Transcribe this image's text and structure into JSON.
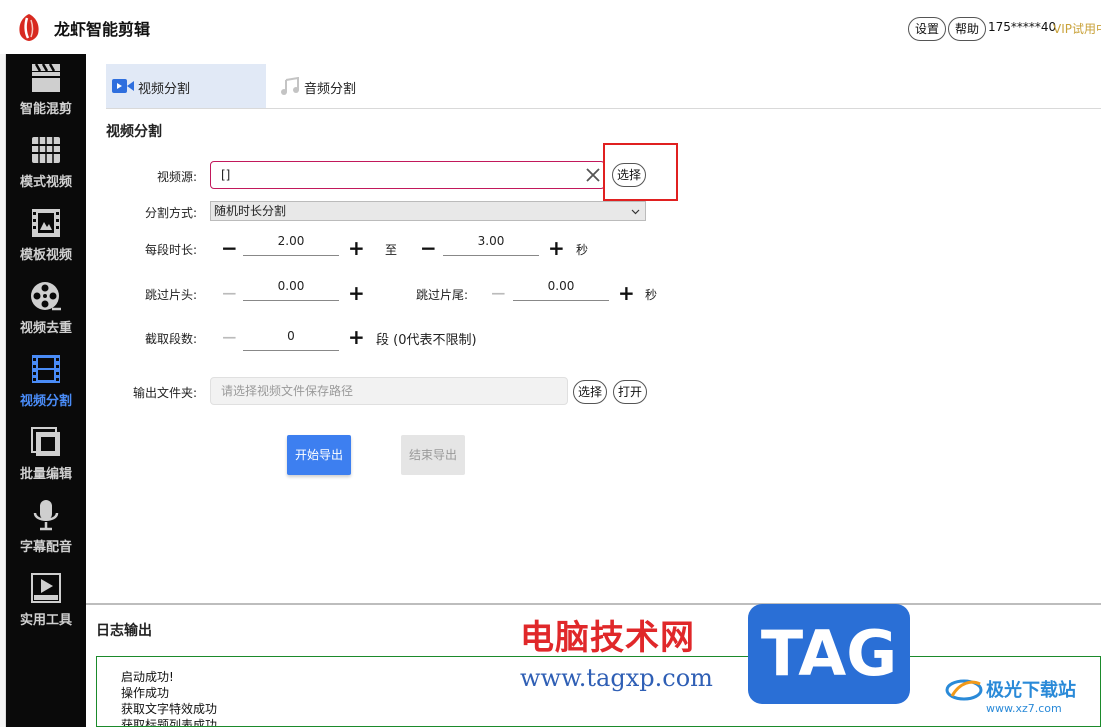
{
  "app": {
    "title": "龙虾智能剪辑",
    "settings_label": "设置",
    "help_label": "帮助",
    "user_id": "175*****40",
    "vip_label": "VIP试用中"
  },
  "sidebar": {
    "items": [
      {
        "label": "智能混剪",
        "icon": "clapperboard-icon"
      },
      {
        "label": "模式视频",
        "icon": "film-stack-icon"
      },
      {
        "label": "模板视频",
        "icon": "template-film-icon"
      },
      {
        "label": "视频去重",
        "icon": "film-reel-icon"
      },
      {
        "label": "视频分割",
        "icon": "film-strip-icon",
        "active": true
      },
      {
        "label": "批量编辑",
        "icon": "batch-edit-icon"
      },
      {
        "label": "字幕配音",
        "icon": "microphone-icon"
      },
      {
        "label": "实用工具",
        "icon": "logo-play-icon"
      }
    ],
    "active_color": "#4a8cf7"
  },
  "tabs": [
    {
      "label": "视频分割",
      "icon": "video-camera-icon",
      "active": true
    },
    {
      "label": "音频分割",
      "icon": "music-note-icon",
      "active": false
    }
  ],
  "section_title": "视频分割",
  "form": {
    "source_label": "视频源:",
    "source_value": "[]",
    "choose_label": "选择",
    "split_mode_label": "分割方式:",
    "split_mode_value": "随机时长分割",
    "segment_duration_label": "每段时长:",
    "duration_min": "2.00",
    "to_label": "至",
    "duration_max": "3.00",
    "seconds_unit": "秒",
    "skip_head_label": "跳过片头:",
    "skip_head_value": "0.00",
    "skip_tail_label": "跳过片尾:",
    "skip_tail_value": "0.00",
    "segment_count_label": "截取段数:",
    "segment_count_value": "0",
    "segment_count_hint": "段 (0代表不限制)",
    "output_folder_label": "输出文件夹:",
    "output_folder_placeholder": "请选择视频文件保存路径",
    "output_choose_label": "选择",
    "output_open_label": "打开",
    "minus": "−",
    "plus": "+"
  },
  "actions": {
    "start_label": "开始导出",
    "stop_label": "结束导出"
  },
  "log": {
    "title": "日志输出",
    "lines": [
      "启动成功!",
      "操作成功",
      "获取文字特效成功",
      "获取标题列表成功"
    ]
  },
  "watermark": {
    "site_cn": "电脑技术网",
    "site_url": "www.tagxp.com",
    "tag": "TAG",
    "xz_cn": "极光下载站",
    "xz_url": "www.xz7.com"
  },
  "colors": {
    "primary": "#3d7ff0",
    "highlight_box": "#e02020",
    "source_border": "#c2185b",
    "log_border": "#1b8a2b"
  }
}
